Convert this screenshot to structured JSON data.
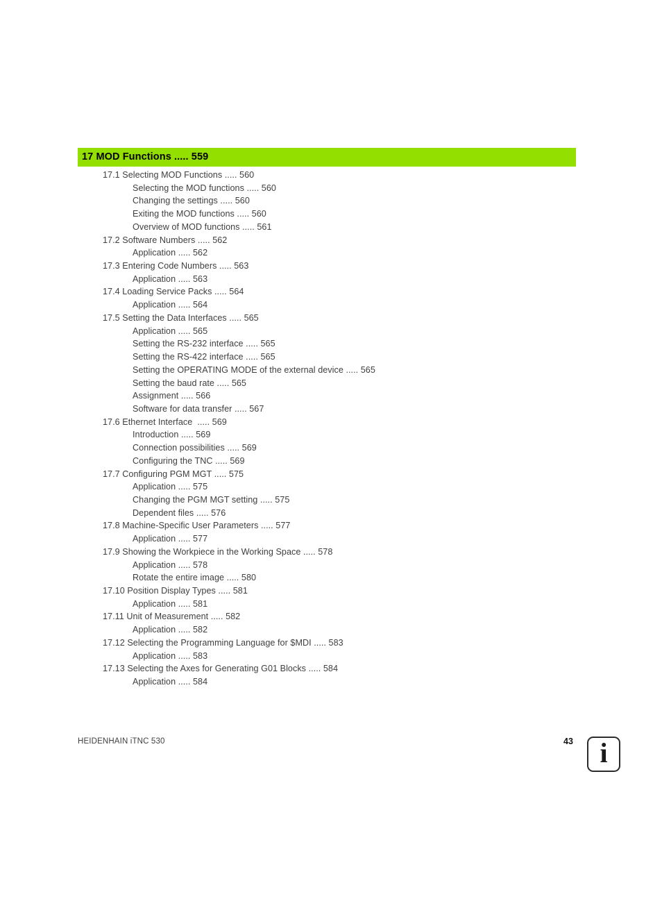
{
  "chapter": {
    "heading": "17 MOD Functions ..... 559",
    "bar_color": "#93E000",
    "text_color": "#000000"
  },
  "toc": {
    "entries": [
      {
        "level": 1,
        "text": "17.1 Selecting MOD Functions ..... 560"
      },
      {
        "level": 2,
        "text": "Selecting the MOD functions ..... 560"
      },
      {
        "level": 2,
        "text": "Changing the settings ..... 560"
      },
      {
        "level": 2,
        "text": "Exiting the MOD functions ..... 560"
      },
      {
        "level": 2,
        "text": "Overview of MOD functions ..... 561"
      },
      {
        "level": 1,
        "text": "17.2 Software Numbers ..... 562"
      },
      {
        "level": 2,
        "text": "Application ..... 562"
      },
      {
        "level": 1,
        "text": "17.3 Entering Code Numbers ..... 563"
      },
      {
        "level": 2,
        "text": "Application ..... 563"
      },
      {
        "level": 1,
        "text": "17.4 Loading Service Packs ..... 564"
      },
      {
        "level": 2,
        "text": "Application ..... 564"
      },
      {
        "level": 1,
        "text": "17.5 Setting the Data Interfaces ..... 565"
      },
      {
        "level": 2,
        "text": "Application ..... 565"
      },
      {
        "level": 2,
        "text": "Setting the RS-232 interface ..... 565"
      },
      {
        "level": 2,
        "text": "Setting the RS-422 interface ..... 565"
      },
      {
        "level": 2,
        "text": "Setting the OPERATING MODE of the external device ..... 565"
      },
      {
        "level": 2,
        "text": "Setting the baud rate ..... 565"
      },
      {
        "level": 2,
        "text": "Assignment ..... 566"
      },
      {
        "level": 2,
        "text": "Software for data transfer ..... 567"
      },
      {
        "level": 1,
        "text": "17.6 Ethernet Interface  ..... 569"
      },
      {
        "level": 2,
        "text": "Introduction ..... 569"
      },
      {
        "level": 2,
        "text": "Connection possibilities ..... 569"
      },
      {
        "level": 2,
        "text": "Configuring the TNC ..... 569"
      },
      {
        "level": 1,
        "text": "17.7 Configuring PGM MGT ..... 575"
      },
      {
        "level": 2,
        "text": "Application ..... 575"
      },
      {
        "level": 2,
        "text": "Changing the PGM MGT setting ..... 575"
      },
      {
        "level": 2,
        "text": "Dependent files ..... 576"
      },
      {
        "level": 1,
        "text": "17.8 Machine-Specific User Parameters ..... 577"
      },
      {
        "level": 2,
        "text": "Application ..... 577"
      },
      {
        "level": 1,
        "text": "17.9 Showing the Workpiece in the Working Space ..... 578"
      },
      {
        "level": 2,
        "text": "Application ..... 578"
      },
      {
        "level": 2,
        "text": "Rotate the entire image ..... 580"
      },
      {
        "level": 1,
        "text": "17.10 Position Display Types ..... 581"
      },
      {
        "level": 2,
        "text": "Application ..... 581"
      },
      {
        "level": 1,
        "text": "17.11 Unit of Measurement ..... 582"
      },
      {
        "level": 2,
        "text": "Application ..... 582"
      },
      {
        "level": 1,
        "text": "17.12 Selecting the Programming Language for $MDI ..... 583"
      },
      {
        "level": 2,
        "text": "Application ..... 583"
      },
      {
        "level": 1,
        "text": "17.13 Selecting the Axes for Generating G01 Blocks ..... 584"
      },
      {
        "level": 2,
        "text": "Application ..... 584"
      }
    ]
  },
  "footer": {
    "brand": "HEIDENHAIN iTNC 530",
    "page_number": "43",
    "info_icon_glyph": "i"
  }
}
